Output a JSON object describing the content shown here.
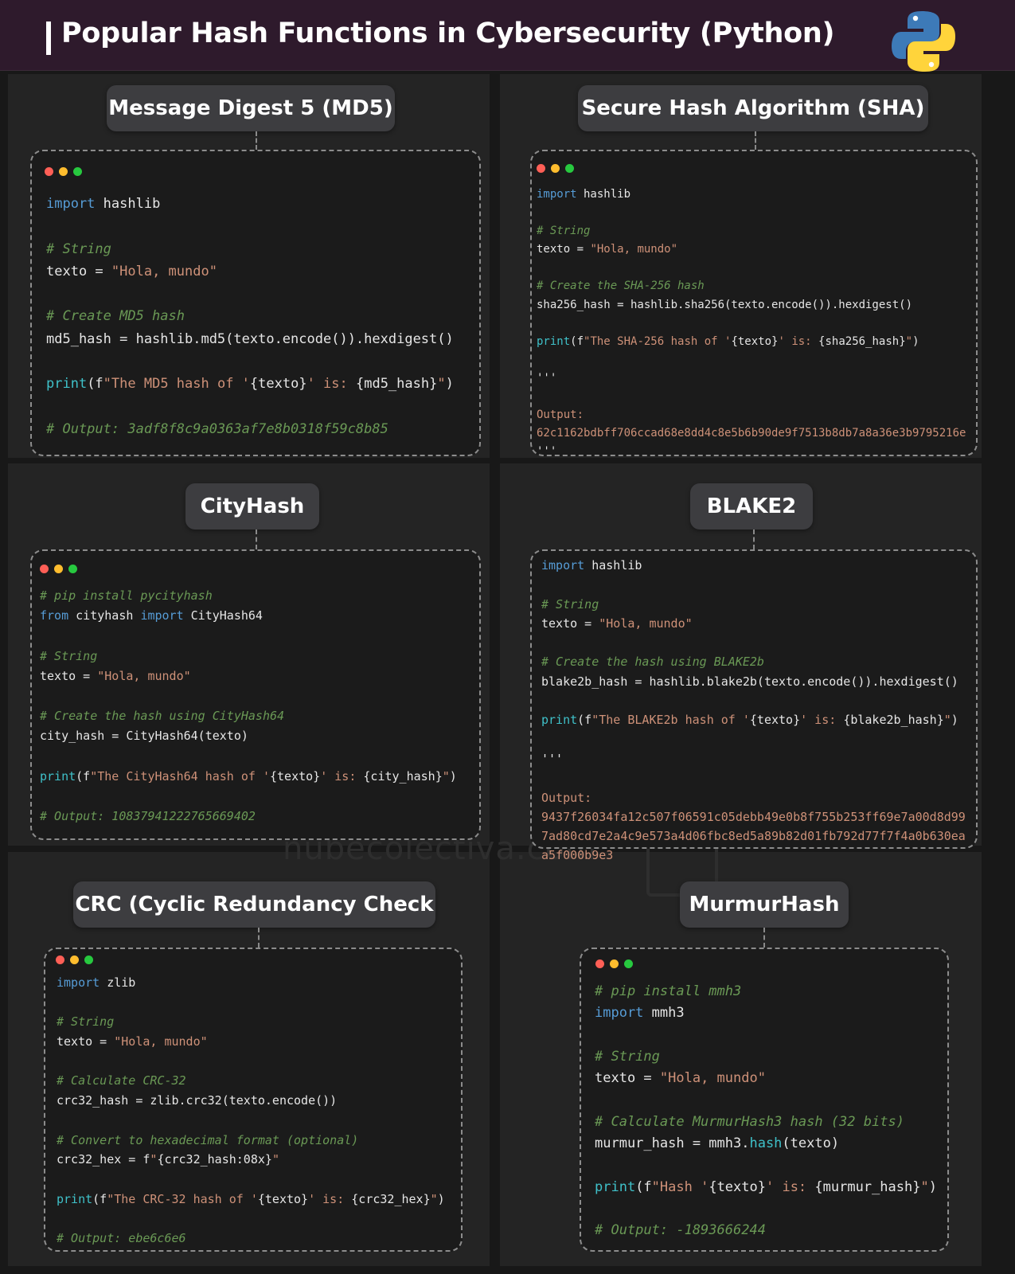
{
  "header": {
    "title": "Popular Hash Functions in Cybersecurity (Python)",
    "logo_icon": "python-logo-icon",
    "background_color": "#2e1a2c"
  },
  "watermark": "nubecolectiva.com",
  "colors": {
    "keyword": "#569cd6",
    "string": "#ce9178",
    "comment": "#6a9955",
    "function": "#3fc1c9",
    "pill_background": "#3d3d40"
  },
  "panels": [
    {
      "title": "Message Digest 5 (MD5)",
      "code": [
        [
          [
            "kw",
            "import"
          ],
          [
            "",
            " hashlib"
          ]
        ],
        [],
        [
          [
            "cm",
            "# String"
          ]
        ],
        [
          [
            "",
            "texto = "
          ],
          [
            "st",
            "\"Hola, mundo\""
          ]
        ],
        [],
        [
          [
            "cm",
            "# Create MD5 hash"
          ]
        ],
        [
          [
            "",
            "md5_hash = hashlib.md5(texto.encode()).hexdigest()"
          ]
        ],
        [],
        [
          [
            "fn",
            "print"
          ],
          [
            "",
            "(f"
          ],
          [
            "st",
            "\"The MD5 hash of '"
          ],
          [
            "",
            "{texto}"
          ],
          [
            "st",
            "' is: "
          ],
          [
            "",
            "{md5_hash}"
          ],
          [
            "st",
            "\""
          ],
          [
            "",
            ")"
          ]
        ],
        [],
        [
          [
            "cm",
            "# Output: 3adf8f8c9a0363af7e8b0318f59c8b85"
          ]
        ]
      ]
    },
    {
      "title": "Secure Hash Algorithm (SHA)",
      "code": [
        [
          [
            "kw",
            "import"
          ],
          [
            "",
            " hashlib"
          ]
        ],
        [],
        [
          [
            "cm",
            "# String"
          ]
        ],
        [
          [
            "",
            "texto = "
          ],
          [
            "st",
            "\"Hola, mundo\""
          ]
        ],
        [],
        [
          [
            "cm",
            "# Create the SHA-256 hash"
          ]
        ],
        [
          [
            "",
            "sha256_hash = hashlib.sha256(texto.encode()).hexdigest()"
          ]
        ],
        [],
        [
          [
            "fn",
            "print"
          ],
          [
            "",
            "(f"
          ],
          [
            "st",
            "\"The SHA-256 hash of '"
          ],
          [
            "",
            "{texto}"
          ],
          [
            "st",
            "' is: "
          ],
          [
            "",
            "{sha256_hash}"
          ],
          [
            "st",
            "\""
          ],
          [
            "",
            ")"
          ]
        ],
        [],
        [
          [
            "",
            "'''"
          ]
        ],
        [],
        [
          [
            "out",
            "Output:"
          ]
        ],
        [
          [
            "out",
            "62c1162bdbff706ccad68e8dd4c8e5b6b90de9f7513b8db7a8a36e3b9795216e"
          ]
        ],
        [
          [
            "",
            "'''"
          ]
        ]
      ]
    },
    {
      "title": "CityHash",
      "code": [
        [
          [
            "cm",
            "# pip install pycityhash"
          ]
        ],
        [
          [
            "kw",
            "from"
          ],
          [
            "",
            " cityhash "
          ],
          [
            "kw",
            "import"
          ],
          [
            "",
            " CityHash64"
          ]
        ],
        [],
        [
          [
            "cm",
            "# String"
          ]
        ],
        [
          [
            "",
            "texto = "
          ],
          [
            "st",
            "\"Hola, mundo\""
          ]
        ],
        [],
        [
          [
            "cm",
            "# Create the hash using CityHash64"
          ]
        ],
        [
          [
            "",
            "city_hash = CityHash64(texto)"
          ]
        ],
        [],
        [
          [
            "fn",
            "print"
          ],
          [
            "",
            "(f"
          ],
          [
            "st",
            "\"The CityHash64 hash of '"
          ],
          [
            "",
            "{texto}"
          ],
          [
            "st",
            "' is: "
          ],
          [
            "",
            "{city_hash}"
          ],
          [
            "st",
            "\""
          ],
          [
            "",
            ")"
          ]
        ],
        [],
        [
          [
            "cm",
            "# Output: 10837941222765669402"
          ]
        ]
      ]
    },
    {
      "title": "BLAKE2",
      "code": [
        [
          [
            "kw",
            "import"
          ],
          [
            "",
            " hashlib"
          ]
        ],
        [],
        [
          [
            "cm",
            "# String"
          ]
        ],
        [
          [
            "",
            "texto = "
          ],
          [
            "st",
            "\"Hola, mundo\""
          ]
        ],
        [],
        [
          [
            "cm",
            "# Create the hash using BLAKE2b"
          ]
        ],
        [
          [
            "",
            "blake2b_hash = hashlib.blake2b(texto.encode()).hexdigest()"
          ]
        ],
        [],
        [
          [
            "fn",
            "print"
          ],
          [
            "",
            "(f"
          ],
          [
            "st",
            "\"The BLAKE2b hash of '"
          ],
          [
            "",
            "{texto}"
          ],
          [
            "st",
            "' is: "
          ],
          [
            "",
            "{blake2b_hash}"
          ],
          [
            "st",
            "\""
          ],
          [
            "",
            ")"
          ]
        ],
        [],
        [
          [
            "",
            "'''"
          ]
        ],
        [],
        [
          [
            "out",
            "Output:"
          ]
        ],
        [
          [
            "out",
            "9437f26034fa12c507f06591c05debb49e0b8f755b253ff69e7a00d8d99"
          ]
        ],
        [
          [
            "out",
            "7ad80cd7e2a4c9e573a4d06fbc8ed5a89b82d01fb792d77f7f4a0b630ea"
          ]
        ],
        [
          [
            "out",
            "a5f000b9e3"
          ]
        ]
      ]
    },
    {
      "title": "CRC (Cyclic Redundancy Check",
      "code": [
        [
          [
            "kw",
            "import"
          ],
          [
            "",
            " zlib"
          ]
        ],
        [],
        [
          [
            "cm",
            "# String"
          ]
        ],
        [
          [
            "",
            "texto = "
          ],
          [
            "st",
            "\"Hola, mundo\""
          ]
        ],
        [],
        [
          [
            "cm",
            "# Calculate CRC-32"
          ]
        ],
        [
          [
            "",
            "crc32_hash = zlib.crc32(texto.encode())"
          ]
        ],
        [],
        [
          [
            "cm",
            "# Convert to hexadecimal format (optional)"
          ]
        ],
        [
          [
            "",
            "crc32_hex = f"
          ],
          [
            "st",
            "\""
          ],
          [
            "",
            "{crc32_hash:08x}"
          ],
          [
            "st",
            "\""
          ]
        ],
        [],
        [
          [
            "fn",
            "print"
          ],
          [
            "",
            "(f"
          ],
          [
            "st",
            "\"The CRC-32 hash of '"
          ],
          [
            "",
            "{texto}"
          ],
          [
            "st",
            "' is: "
          ],
          [
            "",
            "{crc32_hex}"
          ],
          [
            "st",
            "\""
          ],
          [
            "",
            ")"
          ]
        ],
        [],
        [
          [
            "cm",
            "# Output: ebe6c6e6"
          ]
        ]
      ]
    },
    {
      "title": "MurmurHash",
      "code": [
        [
          [
            "cm",
            "# pip install mmh3"
          ]
        ],
        [
          [
            "kw",
            "import"
          ],
          [
            "",
            " mmh3"
          ]
        ],
        [],
        [
          [
            "cm",
            "# String"
          ]
        ],
        [
          [
            "",
            "texto = "
          ],
          [
            "st",
            "\"Hola, mundo\""
          ]
        ],
        [],
        [
          [
            "cm",
            "# Calculate MurmurHash3 hash (32 bits)"
          ]
        ],
        [
          [
            "",
            "murmur_hash = mmh3."
          ],
          [
            "fn",
            "hash"
          ],
          [
            "",
            "(texto)"
          ]
        ],
        [],
        [
          [
            "fn",
            "print"
          ],
          [
            "",
            "(f"
          ],
          [
            "st",
            "\"Hash '"
          ],
          [
            "",
            "{texto}"
          ],
          [
            "st",
            "' is: "
          ],
          [
            "",
            "{murmur_hash}"
          ],
          [
            "st",
            "\""
          ],
          [
            "",
            ")"
          ]
        ],
        [],
        [
          [
            "cm",
            "# Output: -1893666244"
          ]
        ]
      ]
    }
  ]
}
